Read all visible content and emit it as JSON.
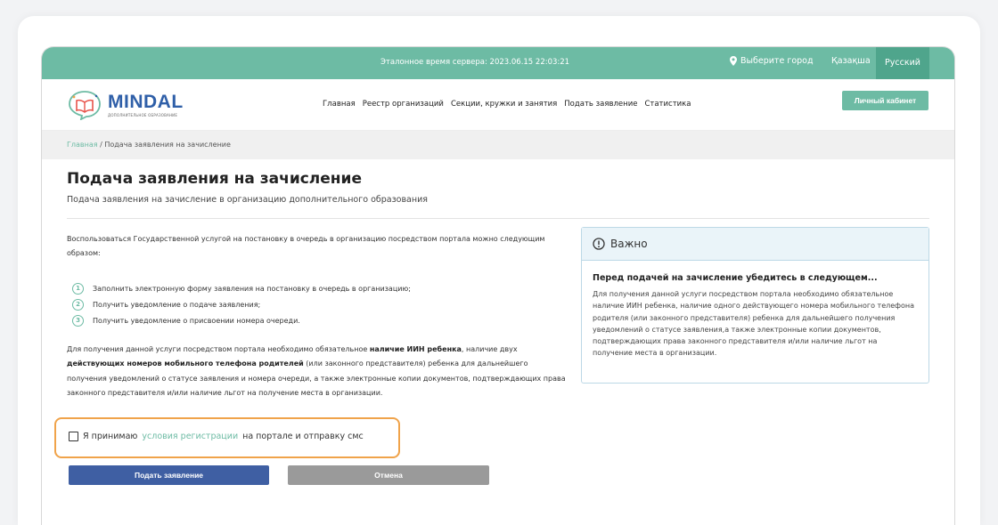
{
  "topbar": {
    "server_time": "Эталонное время сервера: 2023.06.15 22:03:21",
    "city_label": "Выберите город",
    "lang_kz": "Қазақша",
    "lang_ru": "Русский",
    "accent_color": "#6dbba4",
    "icons": {
      "city": "map-pin-icon"
    }
  },
  "header": {
    "logo_name": "MINDAL",
    "logo_sub": "ДОПОЛНИТЕЛЬНОЕ ОБРАЗОВАНИЕ",
    "nav": [
      "Главная",
      "Реестр организаций",
      "Секции, кружки и занятия",
      "Подать заявление",
      "Статистика"
    ],
    "cabinet_button": "Личный кабинет"
  },
  "breadcrumb": {
    "home": "Главная",
    "separator": "/",
    "current": "Подача заявления на зачисление"
  },
  "main": {
    "title": "Подача заявления на зачисление",
    "subtitle": "Подача заявления на зачисление в организацию дополнительного образования",
    "intro": "Воспользоваться Государственной услугой на постановку в очередь в организацию посредством портала можно следующим образом:",
    "steps": [
      {
        "num": "1",
        "text": "Заполнить электронную форму заявления на постановку в очередь в организацию;"
      },
      {
        "num": "2",
        "text": "Получить уведомление о подаче заявления;"
      },
      {
        "num": "3",
        "text": "Получить уведомление о присвоении номера очереди."
      }
    ],
    "details": {
      "part1": "Для получения данной услуги посредством портала необходимо обязательное ",
      "bold1": "наличие ИИН ребенка",
      "part2": ", наличие двух ",
      "bold2": "действующих номеров мобильного телефона родителей",
      "part3": " (или законного представителя) ребенка для дальнейшего получения уведомлений о статусе заявления и номера очереди, а также электронные копии документов, подтверждающих права законного представителя и/или наличие льгот на получение места в организации."
    },
    "important": {
      "header": "Важно",
      "title": "Перед подачей на зачисление убедитесь в следующем...",
      "text": "Для получения данной услуги посредством портала необходимо обязательное наличие ИИН ребенка, наличие одного действующего номера мобильного телефона родителя (или законного представителя) ребенка для дальнейшего получения уведомлений о статусе заявления,а также электронные копии документов, подтверждающих права законного представителя и/или наличие льгот на получение места в организации.",
      "icon": "warning-circle-icon"
    },
    "agree": {
      "checked": false,
      "part1": "Я принимаю ",
      "link": "условия регистрации",
      "part2": " на портале и отправку смс",
      "highlight_color": "#f0a34a"
    },
    "buttons": {
      "submit": "Подать заявление",
      "cancel": "Отмена",
      "submit_color": "#3f5fa3",
      "cancel_color": "#9a9a9a"
    }
  }
}
